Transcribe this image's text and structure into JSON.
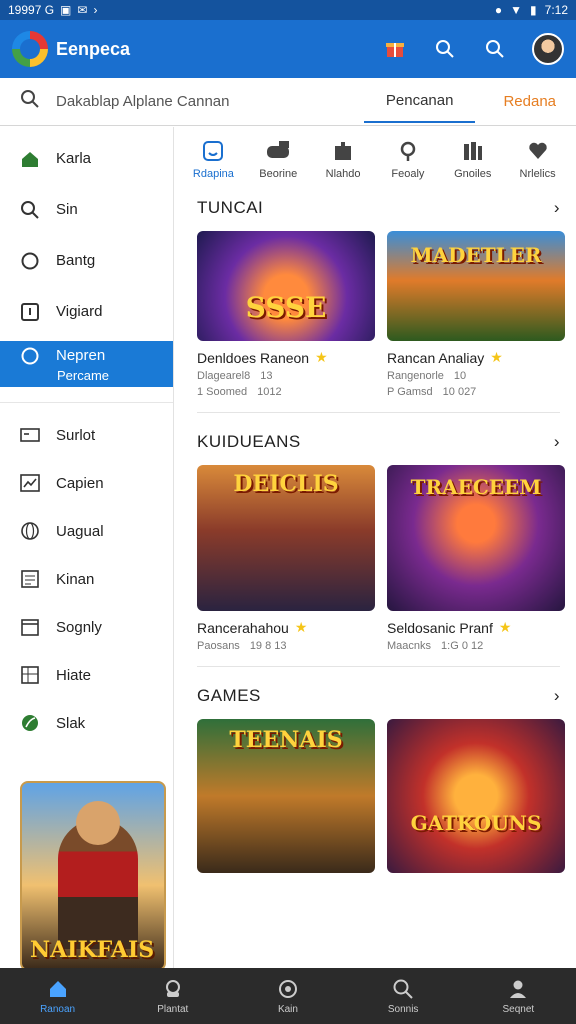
{
  "status_bar": {
    "time_left": "19997 G",
    "time_right": "7:12"
  },
  "app_bar": {
    "title": "Eenpeca"
  },
  "search": {
    "placeholder": "Dakablap Alplane Cannan",
    "tabs": [
      "Pencanan",
      "Redana"
    ]
  },
  "sidebar": {
    "items": [
      {
        "label": "Karla",
        "icon": "home-icon"
      },
      {
        "label": "Sin",
        "icon": "search-icon"
      },
      {
        "label": "Bantg",
        "icon": "circle-icon"
      },
      {
        "label": "Vigiard",
        "icon": "info-icon"
      }
    ],
    "selected": {
      "label": "Nepren",
      "sub": "Percame"
    },
    "items2": [
      {
        "label": "Surlot",
        "icon": "card-icon"
      },
      {
        "label": "Capien",
        "icon": "chart-icon"
      },
      {
        "label": "Uagual",
        "icon": "globe-icon"
      },
      {
        "label": "Kinan",
        "icon": "document-icon"
      },
      {
        "label": "Sognly",
        "icon": "calendar-icon"
      },
      {
        "label": "Hiate",
        "icon": "table-icon"
      },
      {
        "label": "Slak",
        "icon": "leaf-icon"
      }
    ],
    "promo_title": "NAIKFAIS"
  },
  "categories": [
    {
      "label": "Rdapina",
      "icon": "face-icon",
      "active": true
    },
    {
      "label": "Beorine",
      "icon": "controller-icon"
    },
    {
      "label": "Nlahdo",
      "icon": "box-icon"
    },
    {
      "label": "Feoaly",
      "icon": "pin-icon"
    },
    {
      "label": "Gnoiles",
      "icon": "grid-icon"
    },
    {
      "label": "Nrlelics",
      "icon": "heart-icon"
    }
  ],
  "sections": [
    {
      "title": "TUNCAI",
      "cards": [
        {
          "thumb_text": "SSSE",
          "name": "Denldoes Raneon",
          "meta1": "Dlagearel8",
          "meta2": "13",
          "meta3": "1 Soomed",
          "meta4": "1012"
        },
        {
          "thumb_text": "MADETLER",
          "name": "Rancan Analiay",
          "meta1": "Rangenorle",
          "meta2": "10",
          "meta3": "P Gamsd",
          "meta4": "10 027"
        }
      ]
    },
    {
      "title": "KUIDUEANS",
      "cards": [
        {
          "thumb_text": "DEICLIS",
          "name": "Rancerahahou",
          "meta1": "Paosans",
          "meta2": "19 8 13"
        },
        {
          "thumb_text": "TRAECEEM",
          "name": "Seldosanic Pranf",
          "meta1": "Maacnks",
          "meta2": "1:G 0 12"
        }
      ]
    },
    {
      "title": "GAMES",
      "cards": [
        {
          "thumb_text": "TEENAIS"
        },
        {
          "thumb_text": "GATKOUNS"
        }
      ]
    }
  ],
  "bottom_nav": [
    {
      "label": "Ranoan",
      "icon": "home-icon",
      "active": true
    },
    {
      "label": "Plantat",
      "icon": "controller-icon"
    },
    {
      "label": "Kain",
      "icon": "help-icon"
    },
    {
      "label": "Sonnis",
      "icon": "search-icon"
    },
    {
      "label": "Seqnet",
      "icon": "person-icon"
    }
  ]
}
